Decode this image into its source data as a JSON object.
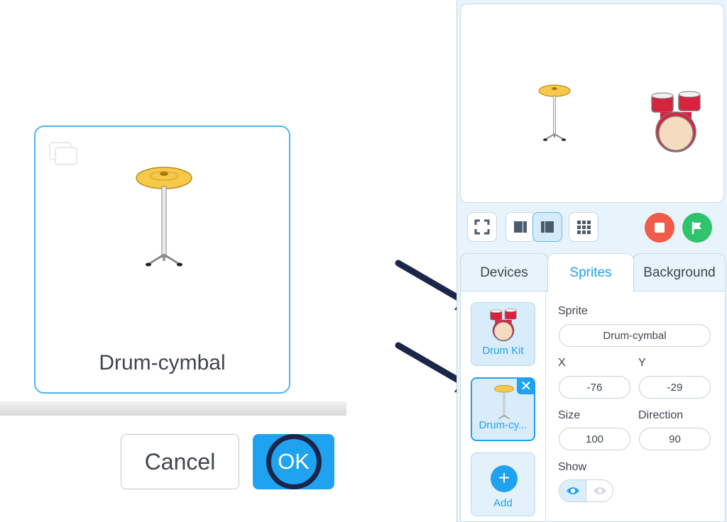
{
  "dialog": {
    "selected_sprite_name": "Drum-cymbal",
    "cancel_label": "Cancel",
    "ok_label": "OK"
  },
  "tabs": [
    "Devices",
    "Sprites",
    "Background"
  ],
  "active_tab": "Sprites",
  "sprite_list": {
    "items": [
      {
        "label": "Drum Kit",
        "icon": "drum-kit-icon"
      },
      {
        "label": "Drum-cy...",
        "icon": "cymbal-icon",
        "close": "✕"
      }
    ],
    "add_label": "Add",
    "add_symbol": "+"
  },
  "sprite_props": {
    "sprite_label": "Sprite",
    "sprite_name": "Drum-cymbal",
    "x_label": "X",
    "x_value": "-76",
    "y_label": "Y",
    "y_value": "-29",
    "size_label": "Size",
    "size_value": "100",
    "direction_label": "Direction",
    "direction_value": "90",
    "show_label": "Show"
  },
  "colors": {
    "accent": "#1fa2f0",
    "stop": "#f15c4a",
    "go": "#2fc36b",
    "arrow": "#1b2549",
    "cymbal": "#f7c948"
  }
}
